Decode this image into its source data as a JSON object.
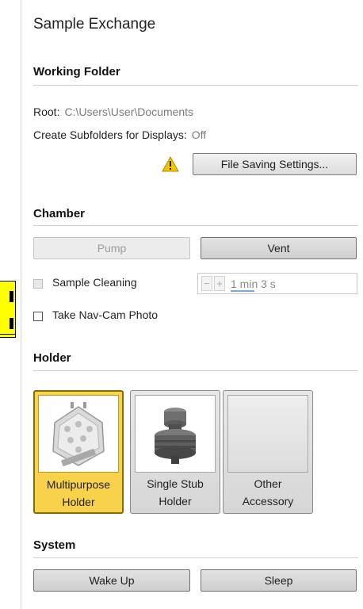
{
  "panel": {
    "title": "Sample Exchange"
  },
  "working_folder": {
    "heading": "Working Folder",
    "root_label": "Root:",
    "root_value": "C:\\Users\\User\\Documents",
    "subfolders_label": "Create Subfolders for Displays:",
    "subfolders_value": "Off",
    "warning_icon": "warning-triangle-icon",
    "file_saving_button": "File Saving Settings..."
  },
  "chamber": {
    "heading": "Chamber",
    "pump_button": "Pump",
    "vent_button": "Vent",
    "sample_cleaning_label": "Sample Cleaning",
    "sample_cleaning_checked": false,
    "sample_cleaning_enabled": false,
    "duration_value": "1 min 3 s",
    "nav_cam_label": "Take Nav-Cam Photo",
    "nav_cam_checked": false
  },
  "holder": {
    "heading": "Holder",
    "items": [
      {
        "line1": "Multipurpose",
        "line2": "Holder",
        "selected": true,
        "icon": "multipurpose-holder-image"
      },
      {
        "line1": "Single Stub",
        "line2": "Holder",
        "selected": false,
        "icon": "single-stub-holder-image"
      },
      {
        "line1": "Other",
        "line2": "Accessory",
        "selected": false,
        "icon": "blank-accessory-image"
      }
    ]
  },
  "system": {
    "heading": "System",
    "wake_button": "Wake Up",
    "sleep_button": "Sleep"
  },
  "colors": {
    "selected_tile": "#f7d24a",
    "highlight_tab": "#ffff00",
    "warning": "#f5c400"
  }
}
